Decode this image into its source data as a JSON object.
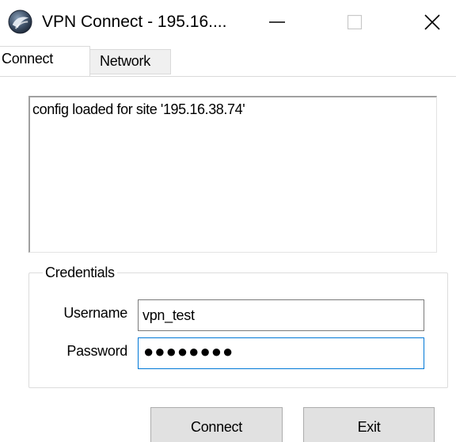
{
  "window": {
    "title": "VPN Connect - 195.16....",
    "icon": "vpn-globe-icon",
    "controls": {
      "minimize": "minimize-icon",
      "maximize": "maximize-icon",
      "close": "close-icon"
    }
  },
  "tabs": [
    {
      "label": "Connect",
      "selected": true
    },
    {
      "label": "Network",
      "selected": false
    }
  ],
  "log": {
    "text": "config loaded for site '195.16.38.74'"
  },
  "credentials": {
    "group_label": "Credentials",
    "username_label": "Username",
    "username_value": "vpn_test",
    "password_label": "Password",
    "password_masked": "●●●●●●●●"
  },
  "buttons": {
    "connect_label": "Connect",
    "exit_label": "Exit"
  },
  "colors": {
    "focus_border": "#0078d7",
    "button_bg": "#e1e1e1",
    "inactive_tab_bg": "#f0f0f0"
  }
}
